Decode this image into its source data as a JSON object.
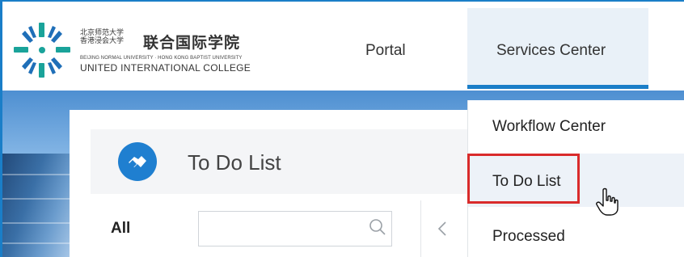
{
  "header": {
    "logo": {
      "cn_small": "北京师范大学\n香港浸会大学",
      "cn_big": "联合国际学院",
      "en_small": "BEIJING NORMAL UNIVERSITY · HONG KONG BAPTIST UNIVERSITY",
      "en_big": "UNITED INTERNATIONAL COLLEGE",
      "colors": {
        "teal": "#1aa39a",
        "blue": "#1f6fb8"
      }
    },
    "nav": [
      {
        "label": "Portal"
      },
      {
        "label": "Services Center",
        "active": true
      }
    ]
  },
  "main": {
    "title": "To Do List",
    "title_icon": "handshake-icon",
    "filter_label": "All",
    "search": {
      "value": "",
      "placeholder": "",
      "icon": "search-icon"
    },
    "prev_icon": "chevron-left-icon"
  },
  "dropdown": {
    "items": [
      {
        "label": "Workflow Center"
      },
      {
        "label": "To Do List",
        "highlighted": true
      },
      {
        "label": "Processed"
      }
    ]
  },
  "colors": {
    "accent": "#1a7ec8",
    "active_nav_bg": "#e9f1f8",
    "highlight_box": "#d92b2b"
  }
}
